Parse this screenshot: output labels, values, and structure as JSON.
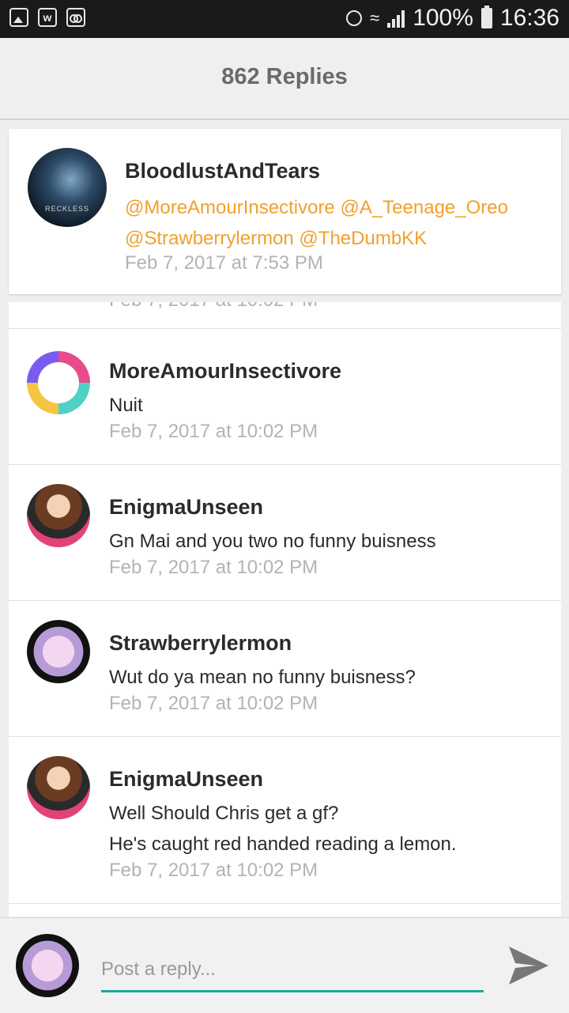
{
  "status_bar": {
    "battery": "100%",
    "time": "16:36",
    "left_icons": [
      "image-icon",
      "w-app-icon",
      "voicemail-icon"
    ],
    "right_icons": [
      "alarm-icon",
      "wifi-icon",
      "signal-icon",
      "battery-icon"
    ]
  },
  "header": {
    "title": "862 Replies"
  },
  "original_post": {
    "author": "BloodlustAndTears",
    "mentions": [
      "@MoreAmourInsectivore",
      "@A_Teenage_Oreo",
      "@Strawberrylermon",
      "@TheDumbKK"
    ],
    "time": "Feb 7, 2017 at 7:53 PM"
  },
  "replies": [
    {
      "author": "MoreAmourInsectivore",
      "lines": [
        "Nuit"
      ],
      "time": "Feb 7, 2017 at 10:02 PM"
    },
    {
      "author": "EnigmaUnseen",
      "lines": [
        "Gn Mai and you two no funny buisness"
      ],
      "time": "Feb 7, 2017 at 10:02 PM"
    },
    {
      "author": "Strawberrylermon",
      "lines": [
        "Wut do ya mean no funny buisness?"
      ],
      "time": "Feb 7, 2017 at 10:02 PM"
    },
    {
      "author": "EnigmaUnseen",
      "lines": [
        "Well Should Chris get a gf?",
        "He's caught red handed reading a lemon."
      ],
      "time": "Feb 7, 2017 at 10:02 PM"
    }
  ],
  "composer": {
    "placeholder": "Post a reply...",
    "accent_color": "#1aa69e"
  },
  "colors": {
    "mention": "#f0a030",
    "timestamp": "#b3b3b3"
  }
}
